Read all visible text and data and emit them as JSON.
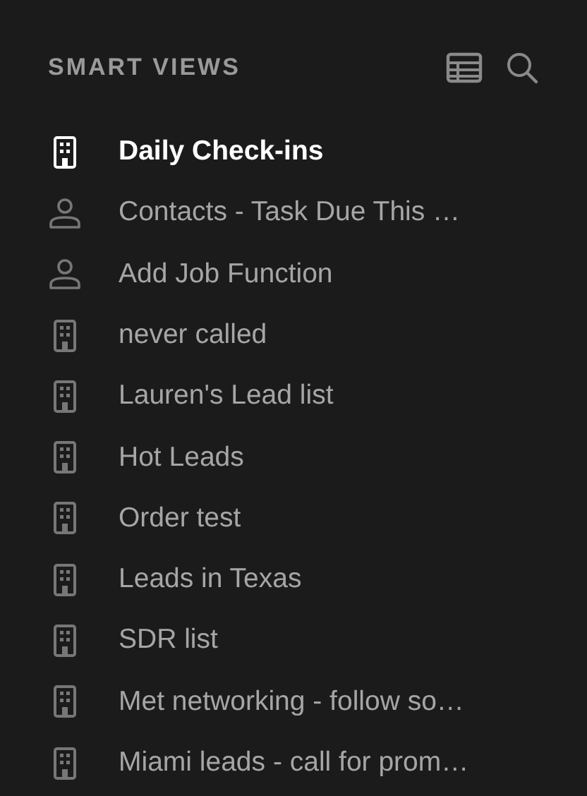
{
  "header": {
    "title": "SMART VIEWS"
  },
  "views": [
    {
      "kind": "company",
      "label": "Daily Check-ins",
      "selected": true
    },
    {
      "kind": "contact",
      "label": "Contacts - Task Due This …",
      "selected": false
    },
    {
      "kind": "contact",
      "label": "Add Job Function",
      "selected": false
    },
    {
      "kind": "company",
      "label": "never called",
      "selected": false
    },
    {
      "kind": "company",
      "label": "Lauren's Lead list",
      "selected": false
    },
    {
      "kind": "company",
      "label": "Hot Leads",
      "selected": false
    },
    {
      "kind": "company",
      "label": "Order test",
      "selected": false
    },
    {
      "kind": "company",
      "label": "Leads in Texas",
      "selected": false
    },
    {
      "kind": "company",
      "label": "SDR list",
      "selected": false
    },
    {
      "kind": "company",
      "label": "Met networking - follow so…",
      "selected": false
    },
    {
      "kind": "company",
      "label": "Miami leads - call for prom…",
      "selected": false
    }
  ]
}
